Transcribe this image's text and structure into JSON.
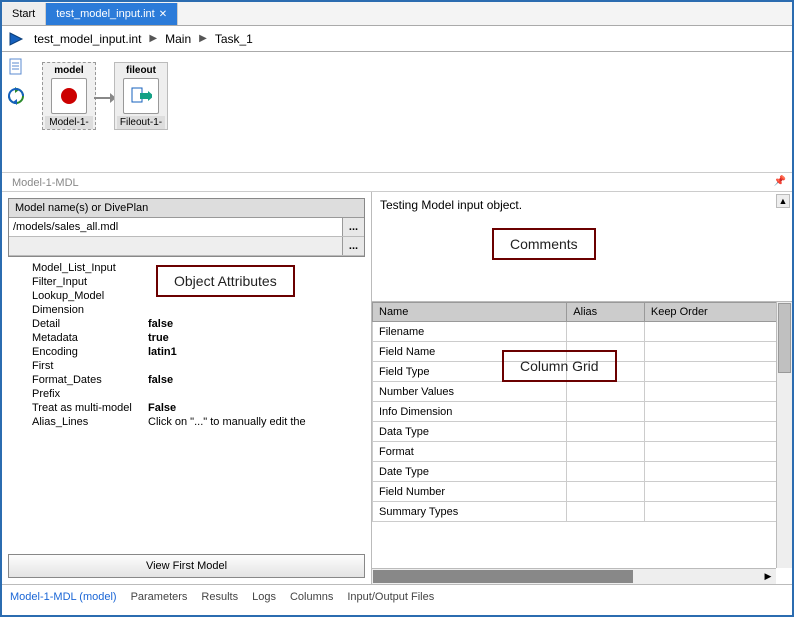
{
  "tabs": {
    "start": "Start",
    "active": "test_model_input.int"
  },
  "breadcrumb": [
    "test_model_input.int",
    "Main",
    "Task_1"
  ],
  "nodes": {
    "model": {
      "title": "model",
      "sub": "Model-1-"
    },
    "fileout": {
      "title": "fileout",
      "sub": "Fileout-1-"
    }
  },
  "panel_label": "Model-1-MDL",
  "model_box": {
    "header": "Model name(s) or DivePlan",
    "path": "/models/sales_all.mdl",
    "empty": "",
    "dots": "..."
  },
  "attributes": [
    {
      "k": "Model_List_Input",
      "v": ""
    },
    {
      "k": "Filter_Input",
      "v": ""
    },
    {
      "k": "Lookup_Model",
      "v": ""
    },
    {
      "k": "Dimension",
      "v": ""
    },
    {
      "k": "Detail",
      "v": "false"
    },
    {
      "k": "Metadata",
      "v": "true"
    },
    {
      "k": "Encoding",
      "v": "latin1"
    },
    {
      "k": "First",
      "v": ""
    },
    {
      "k": "Format_Dates",
      "v": "false"
    },
    {
      "k": "Prefix",
      "v": ""
    },
    {
      "k": "Treat as multi-model",
      "v": "False"
    },
    {
      "k": "Alias_Lines",
      "v": "Click on \"...\" to manually edit the",
      "normal": true
    }
  ],
  "view_button": "View First Model",
  "comments_text": "Testing Model input object.",
  "grid": {
    "headers": [
      "Name",
      "Alias",
      "Keep Order"
    ],
    "rows": [
      "Filename",
      "Field Name",
      "Field Type",
      "Number Values",
      "Info Dimension",
      "Data Type",
      "Format",
      "Date Type",
      "Field Number",
      "Summary Types"
    ]
  },
  "bottom_tabs": [
    "Model-1-MDL (model)",
    "Parameters",
    "Results",
    "Logs",
    "Columns",
    "Input/Output Files"
  ],
  "annotations": {
    "obj_attr": "Object Attributes",
    "comments": "Comments",
    "col_grid": "Column Grid"
  }
}
